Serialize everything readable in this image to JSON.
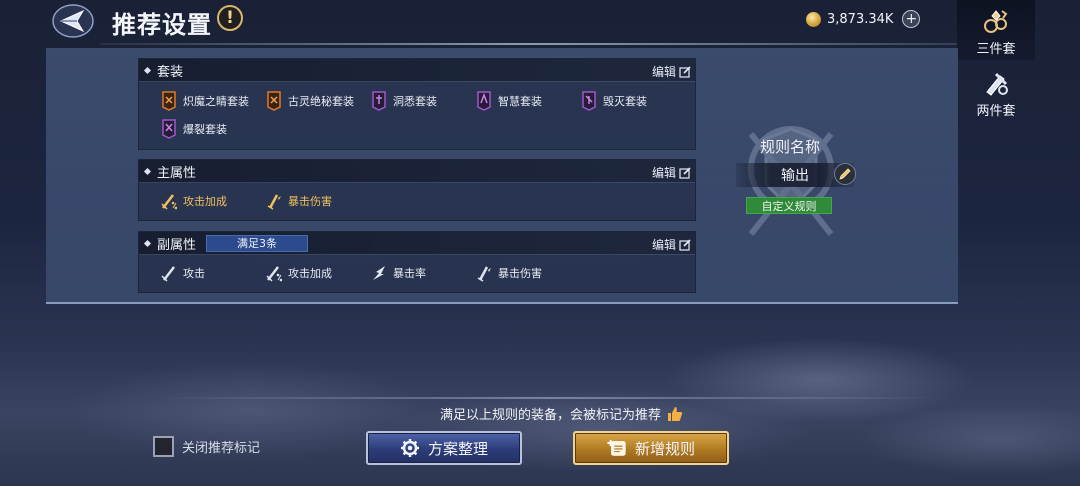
{
  "header": {
    "title": "推荐设置",
    "info_symbol": "!",
    "currency_value": "3,873.34K",
    "plus_symbol": "+"
  },
  "right_tabs": [
    {
      "label": "三件套",
      "active": true,
      "icon": "three-piece-set-icon"
    },
    {
      "label": "两件套",
      "active": false,
      "icon": "two-piece-set-icon"
    }
  ],
  "sets_section": {
    "title": "套装",
    "edit_label": "编辑",
    "items": [
      {
        "label": "炽魔之睛套装",
        "icon": "orange-set-icon",
        "color": "#e07a2a"
      },
      {
        "label": "古灵绝秘套装",
        "icon": "orange-set-icon",
        "color": "#e07a2a"
      },
      {
        "label": "洞悉套装",
        "icon": "purple-set-icon",
        "color": "#9a5ac8"
      },
      {
        "label": "智慧套装",
        "icon": "purple-set-icon",
        "color": "#9a5ac8"
      },
      {
        "label": "毁灭套装",
        "icon": "purple-set-icon",
        "color": "#9a5ac8"
      },
      {
        "label": "爆裂套装",
        "icon": "purple-set-icon",
        "color": "#9a5ac8"
      }
    ]
  },
  "main_attr_section": {
    "title": "主属性",
    "edit_label": "编辑",
    "items": [
      {
        "label": "攻击加成",
        "icon": "sword-percent-icon"
      },
      {
        "label": "暴击伤害",
        "icon": "crit-damage-icon"
      }
    ]
  },
  "sub_attr_section": {
    "title": "副属性",
    "condition": "满足3条",
    "edit_label": "编辑",
    "items": [
      {
        "label": "攻击",
        "icon": "sword-icon"
      },
      {
        "label": "攻击加成",
        "icon": "sword-percent-icon"
      },
      {
        "label": "暴击率",
        "icon": "crit-rate-icon"
      },
      {
        "label": "暴击伤害",
        "icon": "crit-damage-icon"
      }
    ]
  },
  "rule": {
    "name_label": "规则名称",
    "name_value": "输出",
    "custom_badge": "自定义规则"
  },
  "bottom": {
    "notice": "满足以上规则的装备，会被标记为推荐",
    "checkbox_label": "关闭推荐标记",
    "checkbox_checked": false,
    "organize_button": "方案整理",
    "add_rule_button": "新增规则"
  },
  "colors": {
    "gold_text": "#f0c060",
    "condition_badge": "#2d4a8c",
    "custom_badge": "#2f8a3a"
  }
}
